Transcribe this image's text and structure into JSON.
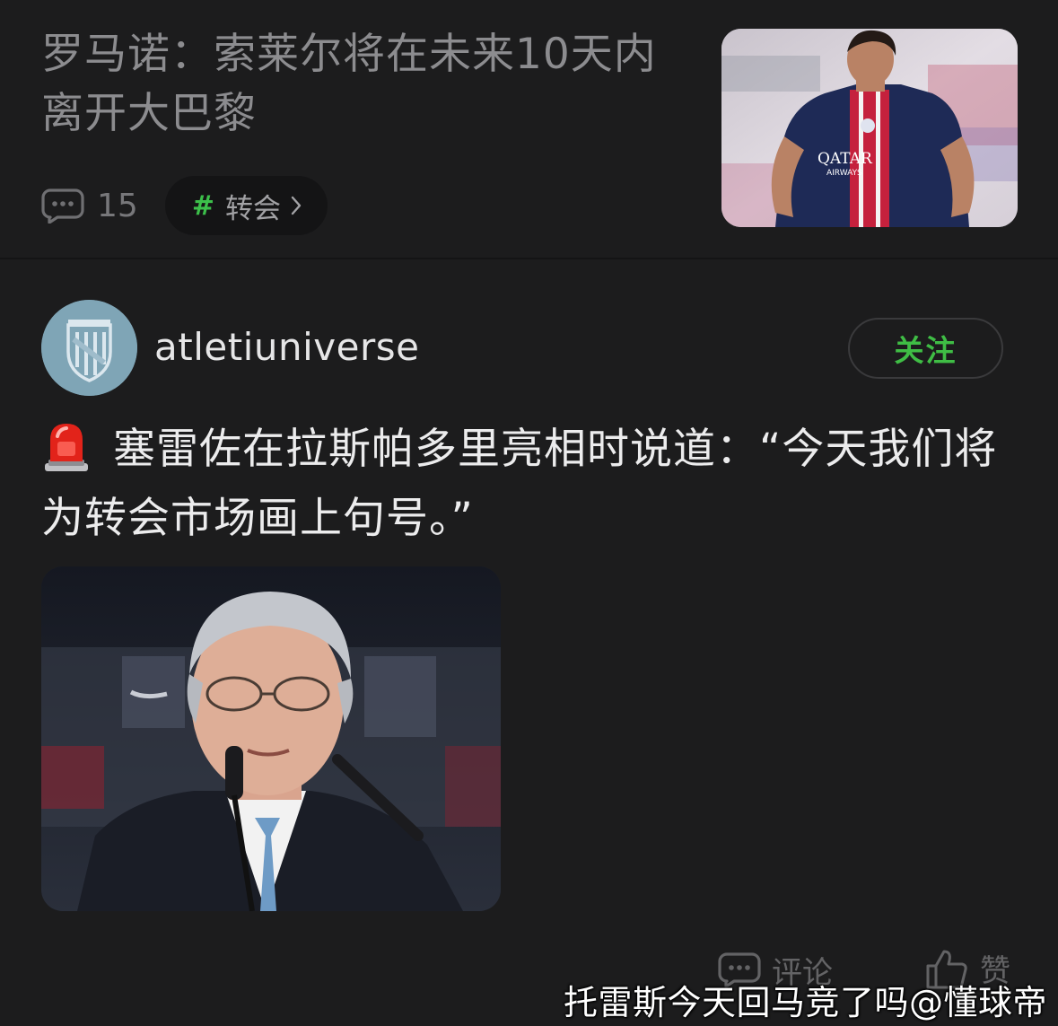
{
  "news": {
    "title": "罗马诺：索莱尔将在未来10天内离开大巴黎",
    "comment_count": "15",
    "tag_hash": "#",
    "tag_label": "转会",
    "thumbnail_icon": "psg-player-photo"
  },
  "post": {
    "username": "atletiuniverse",
    "follow_label": "关注",
    "emoji_icon": "rotating-light-icon",
    "text": "塞雷佐在拉斯帕多里亮相时说道：“今天我们将为转会市场画上句号。”",
    "photo_icon": "press-conference-photo"
  },
  "actions": {
    "comment_label": "评论",
    "like_label": "赞"
  },
  "watermark": "托雷斯今天回马竞了吗@懂球帝",
  "colors": {
    "background": "#1c1c1d",
    "accent_green": "#3fbd45",
    "muted_text": "#8c8c8f"
  }
}
